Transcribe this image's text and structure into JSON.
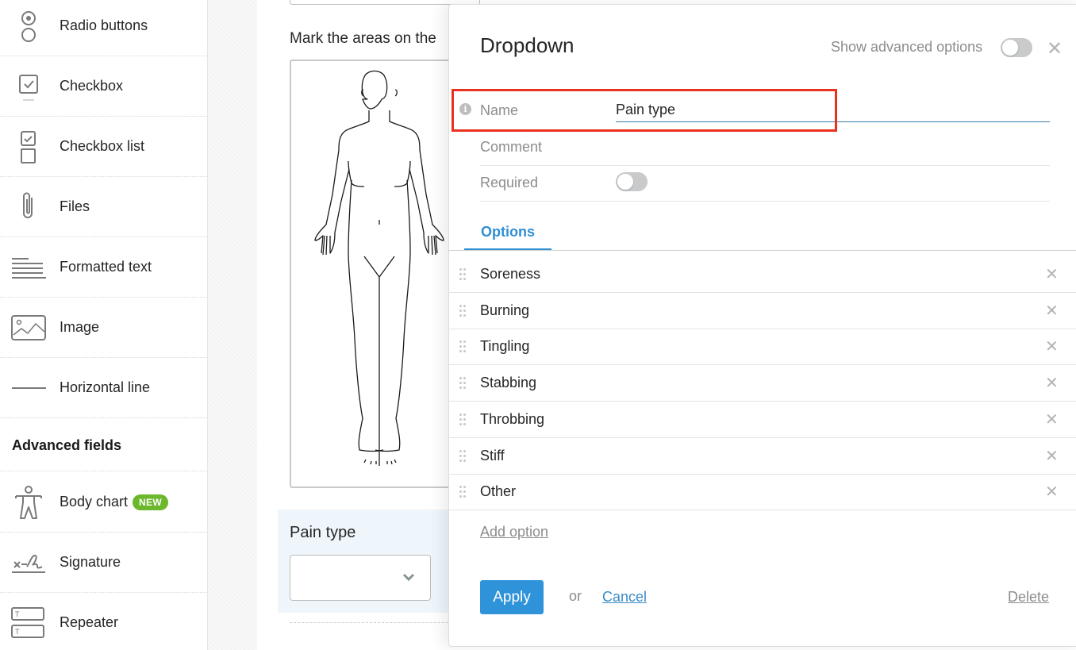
{
  "sidebar": {
    "items": [
      {
        "label": "Radio buttons",
        "icon": "radio-buttons-icon"
      },
      {
        "label": "Checkbox",
        "icon": "checkbox-icon"
      },
      {
        "label": "Checkbox list",
        "icon": "checkbox-list-icon"
      },
      {
        "label": "Files",
        "icon": "paperclip-icon"
      },
      {
        "label": "Formatted text",
        "icon": "formatted-text-icon"
      },
      {
        "label": "Image",
        "icon": "image-icon"
      },
      {
        "label": "Horizontal line",
        "icon": "horizontal-line-icon"
      }
    ],
    "advanced_heading": "Advanced fields",
    "advanced_items": [
      {
        "label": "Body chart",
        "icon": "body-chart-icon",
        "badge": "NEW"
      },
      {
        "label": "Signature",
        "icon": "signature-icon"
      },
      {
        "label": "Repeater",
        "icon": "repeater-icon"
      }
    ]
  },
  "form": {
    "body_question": "Mark the areas on the",
    "selected_field_label": "Pain type",
    "selected_field_value": ""
  },
  "dialog": {
    "title": "Dropdown",
    "advanced_toggle_label": "Show advanced options",
    "advanced_toggle_on": false,
    "fields": {
      "name_label": "Name",
      "name_value": "Pain type",
      "comment_label": "Comment",
      "comment_value": "",
      "required_label": "Required",
      "required_on": false
    },
    "tabs": [
      {
        "label": "Options",
        "active": true
      }
    ],
    "options": [
      "Soreness",
      "Burning",
      "Tingling",
      "Stabbing",
      "Throbbing",
      "Stiff",
      "Other"
    ],
    "add_option_label": "Add option",
    "apply_label": "Apply",
    "or_label": "or",
    "cancel_label": "Cancel",
    "delete_label": "Delete"
  },
  "colors": {
    "accent": "#2f93d9",
    "badge_green": "#6bb82c",
    "highlight_red": "#e8311e"
  }
}
